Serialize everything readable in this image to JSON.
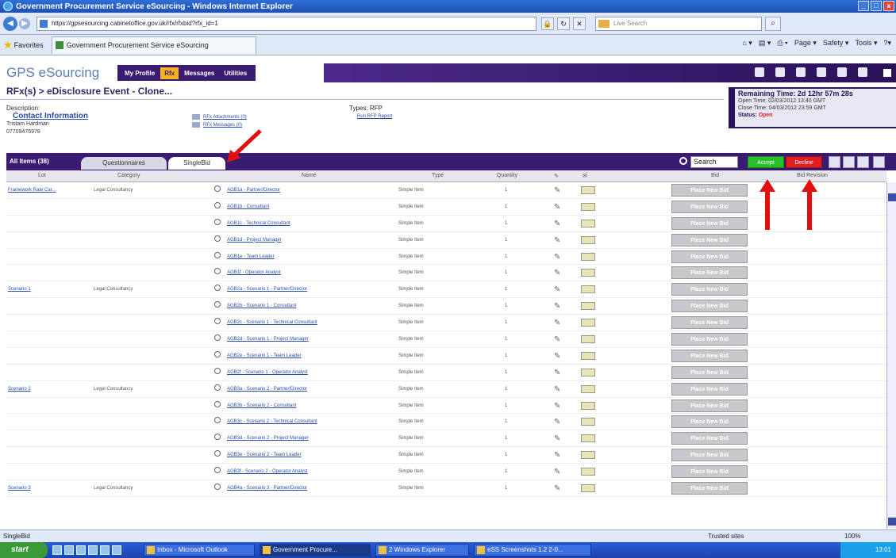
{
  "window": {
    "title": "Government Procurement Service eSourcing - Windows Internet Explorer",
    "controls": [
      "_",
      "□",
      "x"
    ]
  },
  "browser": {
    "url": "https://gpsesourcing.cabinetoffice.gov.uk/rfx/rfxbid?rfx_id=1",
    "search_placeholder": "Live Search",
    "favorites_label": "Favorites",
    "tab_title": "Government Procurement Service eSourcing",
    "commands": [
      "Page ▾",
      "Safety ▾",
      "Tools ▾"
    ]
  },
  "app": {
    "brand": "GPS eSourcing",
    "nav": [
      "My Profile",
      "Rfx",
      "Messages",
      "Utilities"
    ],
    "active_nav": "Rfx"
  },
  "event": {
    "breadcrumb": "RFx(s) > eDisclosure Event - Clone...",
    "description_label": "Description:",
    "contact_link": "Contact Information",
    "contact_name": "Tristam Hardman",
    "contact_phone": "07709476978",
    "attachments_link": "RFx Attachments (0)",
    "messages_link": "RFx Messages (0)",
    "types_label": "Types:",
    "types_value": "RFP",
    "report_link": "Run RFP Report"
  },
  "timer": {
    "remaining": "Remaining Time: 2d 12hr 57m 28s",
    "open_time": "Open Time: 02/03/2012 13:40 GMT",
    "close_time": "Close Time: 04/03/2012 23:59 GMT",
    "status_label": "Status:",
    "status_value": "Open"
  },
  "toolbar": {
    "all_items": "All Items (38)",
    "tabs": [
      "Questionnaires",
      "SingleBid"
    ],
    "active_tab": "SingleBid",
    "search_value": "Search",
    "accept": "Accept",
    "decline": "Decline"
  },
  "table": {
    "columns": [
      "Lot",
      "Category",
      "Name",
      "Type",
      "Quantity",
      "",
      "",
      "Bid",
      "Bid Revision"
    ],
    "bid_label": "Place New Bid",
    "rows": [
      {
        "lot": "Framework Rate Car...",
        "category": "Legal Consultancy",
        "name": "AGB1a - Partner/Director",
        "type": "Simple Item",
        "qty": "1"
      },
      {
        "lot": "",
        "category": "",
        "name": "AGB1b - Consultant",
        "type": "Simple Item",
        "qty": "1"
      },
      {
        "lot": "",
        "category": "",
        "name": "AGB1c - Technical Consultant",
        "type": "Simple Item",
        "qty": "1"
      },
      {
        "lot": "",
        "category": "",
        "name": "AGB1d - Project Manager",
        "type": "Simple Item",
        "qty": "1"
      },
      {
        "lot": "",
        "category": "",
        "name": "AGB1e - Team Leader",
        "type": "Simple Item",
        "qty": "1"
      },
      {
        "lot": "",
        "category": "",
        "name": "AGB1f - Operator Analyst",
        "type": "Simple Item",
        "qty": "1"
      },
      {
        "lot": "Scenario 1",
        "category": "Legal Consultancy",
        "name": "AGB2a - Scenario 1 - Partner/Director",
        "type": "Simple Item",
        "qty": "1"
      },
      {
        "lot": "",
        "category": "",
        "name": "AGB2b - Scenario 1 - Consultant",
        "type": "Simple Item",
        "qty": "1"
      },
      {
        "lot": "",
        "category": "",
        "name": "AGB2c - Scenario 1 - Technical Consultant",
        "type": "Simple Item",
        "qty": "1"
      },
      {
        "lot": "",
        "category": "",
        "name": "AGB2d - Scenario 1 - Project Manager",
        "type": "Simple Item",
        "qty": "1"
      },
      {
        "lot": "",
        "category": "",
        "name": "AGB2e - Scenario 1 - Team Leader",
        "type": "Simple Item",
        "qty": "1"
      },
      {
        "lot": "",
        "category": "",
        "name": "AGB2f - Scenario 1 - Operator Analyst",
        "type": "Simple Item",
        "qty": "1"
      },
      {
        "lot": "Scenario 2",
        "category": "Legal Consultancy",
        "name": "AGB3a - Scenario 2 - Partner/Director",
        "type": "Simple Item",
        "qty": "1"
      },
      {
        "lot": "",
        "category": "",
        "name": "AGB3b - Scenario 2 - Consultant",
        "type": "Simple Item",
        "qty": "1"
      },
      {
        "lot": "",
        "category": "",
        "name": "AGB3c - Scenario 2 - Technical Consultant",
        "type": "Simple Item",
        "qty": "1"
      },
      {
        "lot": "",
        "category": "",
        "name": "AGB3d - Scenario 2 - Project Manager",
        "type": "Simple Item",
        "qty": "1"
      },
      {
        "lot": "",
        "category": "",
        "name": "AGB3e - Scenario 2 - Team Leader",
        "type": "Simple Item",
        "qty": "1"
      },
      {
        "lot": "",
        "category": "",
        "name": "AGB3f - Scenario 2 - Operator Analyst",
        "type": "Simple Item",
        "qty": "1"
      },
      {
        "lot": "Scenario 3",
        "category": "Legal Consultancy",
        "name": "AGB4a - Scenario 3 - Partner/Director",
        "type": "Simple Item",
        "qty": "1"
      }
    ]
  },
  "statusbar": {
    "text": "SingleBid",
    "zone": "Trusted sites",
    "zoom": "100%"
  },
  "taskbar": {
    "start": "start",
    "tasks": [
      "Inbox - Microsoft Outlook",
      "Government Procure...",
      "2 Windows Explorer",
      "eSS Screenshots 1.2 2-0..."
    ],
    "active_task": "Government Procure...",
    "clock": "13:01"
  },
  "colors": {
    "brand_purple": "#3b1a73",
    "accept_green": "#2ac02a",
    "decline_red": "#e02020",
    "arrow_red": "#e01010"
  }
}
